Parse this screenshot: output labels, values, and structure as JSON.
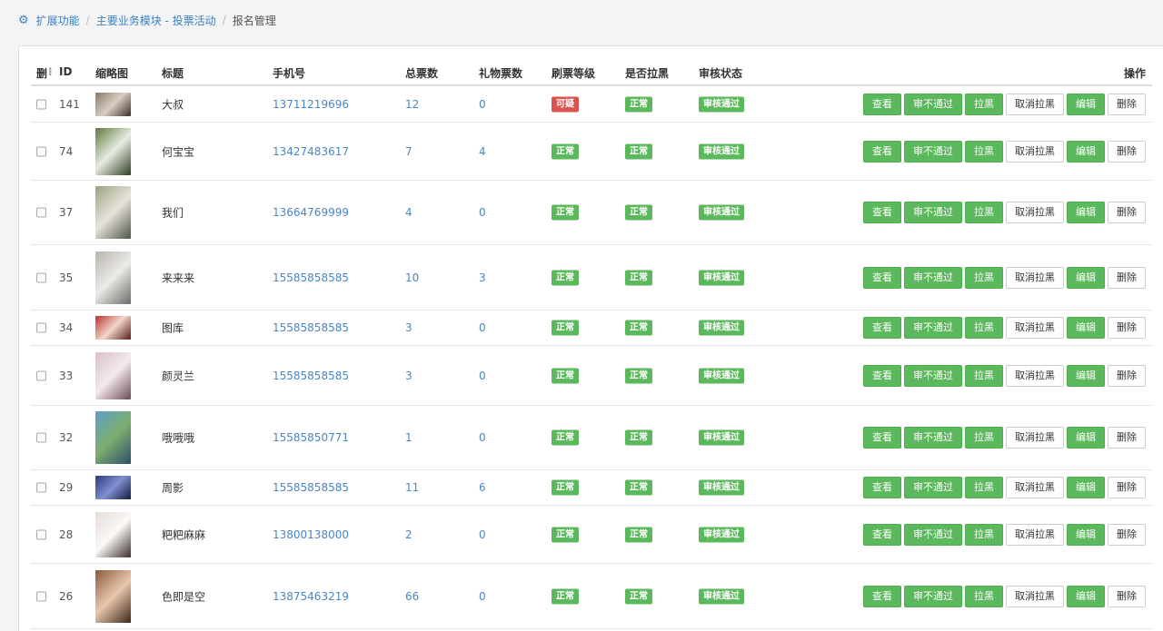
{
  "breadcrumb": {
    "icon": "cogs-icon",
    "items": [
      "扩展功能",
      "主要业务模块 - 投票活动"
    ],
    "current": "报名管理"
  },
  "table": {
    "headers": {
      "del": "删",
      "id": "ID",
      "thumb": "缩略图",
      "title": "标题",
      "phone": "手机号",
      "votes": "总票数",
      "gift_votes": "礼物票数",
      "level": "刷票等级",
      "blacklisted": "是否拉黑",
      "audit": "审核状态",
      "actions": "操作"
    },
    "action_labels": {
      "view": "查看",
      "reject": "审不通过",
      "blacklist": "拉黑",
      "unblacklist": "取消拉黑",
      "edit": "编辑",
      "delete": "删除"
    },
    "rows": [
      {
        "id": "141",
        "title": "大叔",
        "phone": "13711219696",
        "votes": "12",
        "gift_votes": "0",
        "level": "可疑",
        "blacklisted": "正常",
        "audit": "审核通过",
        "thumb_colors": [
          "#8a7766",
          "#d9cfc4",
          "#3a2f2a"
        ]
      },
      {
        "id": "74",
        "title": "何宝宝",
        "phone": "13427483617",
        "votes": "7",
        "gift_votes": "4",
        "level": "正常",
        "blacklisted": "正常",
        "audit": "审核通过",
        "thumb_colors": [
          "#5f7a3e",
          "#e7ece2",
          "#2f3d22"
        ]
      },
      {
        "id": "37",
        "title": "我们",
        "phone": "13664769999",
        "votes": "4",
        "gift_votes": "0",
        "level": "正常",
        "blacklisted": "正常",
        "audit": "审核通过",
        "thumb_colors": [
          "#9aa27e",
          "#e9e4dc",
          "#4d5546"
        ]
      },
      {
        "id": "35",
        "title": "来来来",
        "phone": "15585858585",
        "votes": "10",
        "gift_votes": "3",
        "level": "正常",
        "blacklisted": "正常",
        "audit": "审核通过",
        "thumb_colors": [
          "#b8b4ae",
          "#ecebe8",
          "#6c6a68"
        ]
      },
      {
        "id": "34",
        "title": "图库",
        "phone": "15585858585",
        "votes": "3",
        "gift_votes": "0",
        "level": "正常",
        "blacklisted": "正常",
        "audit": "审核通过",
        "thumb_colors": [
          "#b8322e",
          "#f1d6c9",
          "#5a1d1a"
        ]
      },
      {
        "id": "33",
        "title": "颜灵兰",
        "phone": "15585858585",
        "votes": "3",
        "gift_votes": "0",
        "level": "正常",
        "blacklisted": "正常",
        "audit": "审核通过",
        "thumb_colors": [
          "#d8c0c8",
          "#f3e9ec",
          "#6a4c55"
        ]
      },
      {
        "id": "32",
        "title": "哦哦哦",
        "phone": "15585850771",
        "votes": "1",
        "gift_votes": "0",
        "level": "正常",
        "blacklisted": "正常",
        "audit": "审核通过",
        "thumb_colors": [
          "#5f9ec9",
          "#7dae6c",
          "#2f4e6a"
        ]
      },
      {
        "id": "29",
        "title": "周影",
        "phone": "15585858585",
        "votes": "11",
        "gift_votes": "6",
        "level": "正常",
        "blacklisted": "正常",
        "audit": "审核通过",
        "thumb_colors": [
          "#2b3a7a",
          "#7f8fd0",
          "#141c3d"
        ]
      },
      {
        "id": "28",
        "title": "粑粑麻麻",
        "phone": "13800138000",
        "votes": "2",
        "gift_votes": "0",
        "level": "正常",
        "blacklisted": "正常",
        "audit": "审核通过",
        "thumb_colors": [
          "#e6dcd8",
          "#fbf8f7",
          "#3a2e2c"
        ]
      },
      {
        "id": "26",
        "title": "色即是空",
        "phone": "13875463219",
        "votes": "66",
        "gift_votes": "0",
        "level": "正常",
        "blacklisted": "正常",
        "audit": "审核通过",
        "thumb_colors": [
          "#8c5a3c",
          "#e8c7ad",
          "#3d2618"
        ]
      }
    ]
  },
  "colors": {
    "link": "#3a7fc1",
    "success": "#5cb85c",
    "danger": "#d9534f"
  }
}
